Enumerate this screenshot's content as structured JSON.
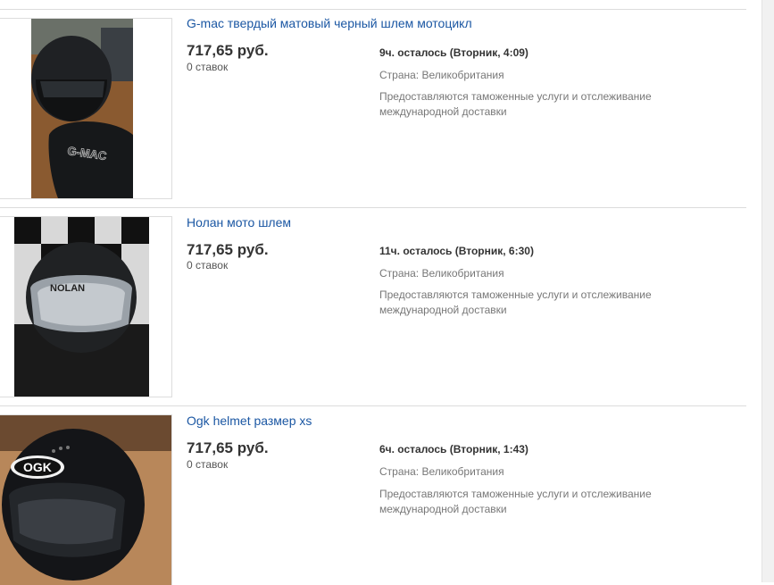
{
  "listings": [
    {
      "title": "G-mac твердый матовый черный шлем мотоцикл",
      "price": "717,65 руб.",
      "bids": "0 ставок",
      "time_left": "9ч. осталось (Вторник, 4:09)",
      "country": "Страна: Великобритания",
      "shipping_note": "Предоставляются таможенные услуги и отслеживание международной доставки",
      "image_brand_text": "G-MAC"
    },
    {
      "title": "Нолан мото шлем",
      "price": "717,65 руб.",
      "bids": "0 ставок",
      "time_left": "11ч. осталось (Вторник, 6:30)",
      "country": "Страна: Великобритания",
      "shipping_note": "Предоставляются таможенные услуги и отслеживание международной доставки",
      "image_brand_text": "NOLAN"
    },
    {
      "title": "Ogk helmet размер xs",
      "price": "717,65 руб.",
      "bids": "0 ставок",
      "time_left": "6ч. осталось (Вторник, 1:43)",
      "country": "Страна: Великобритания",
      "shipping_note": "Предоставляются таможенные услуги и отслеживание международной доставки",
      "image_brand_text": "OGK"
    }
  ]
}
